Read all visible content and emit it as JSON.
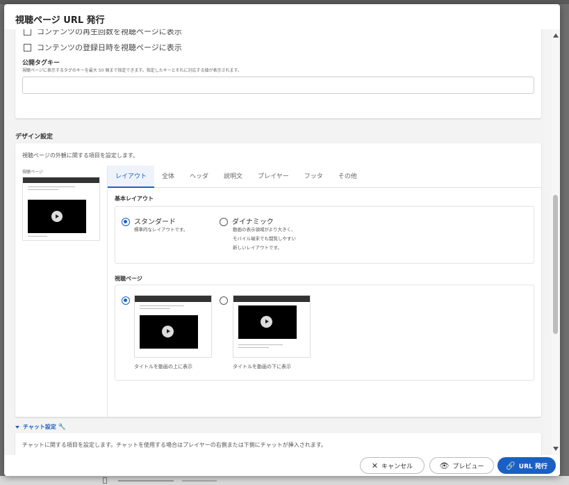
{
  "modal": {
    "title": "視聴ページ URL 発行"
  },
  "content_section": {
    "checkbox_play_count": "コンテンツの再生回数を視聴ページに表示",
    "checkbox_registered_date": "コンテンツの登録日時を視聴ページに表示",
    "public_tag_key": {
      "label": "公開タグキー",
      "help": "視聴ページに表示するタグのキーを最大 50 個まで指定できます。指定したキーとそれに対応する値が表示されます。",
      "value": ""
    }
  },
  "design_section": {
    "heading": "デザイン設定",
    "description": "視聴ページの外観に関する項目を設定します。",
    "preview_label": "視聴ページ",
    "tabs": [
      {
        "label": "レイアウト",
        "active": true
      },
      {
        "label": "全体",
        "active": false
      },
      {
        "label": "ヘッダ",
        "active": false
      },
      {
        "label": "説明文",
        "active": false
      },
      {
        "label": "プレイヤー",
        "active": false
      },
      {
        "label": "フッタ",
        "active": false
      },
      {
        "label": "その他",
        "active": false
      }
    ],
    "basic_layout": {
      "heading": "基本レイアウト",
      "options": [
        {
          "title": "スタンダード",
          "desc": [
            "標準的なレイアウトです。"
          ],
          "selected": true
        },
        {
          "title": "ダイナミック",
          "desc": [
            "動画の表示領域がより大きく、",
            "モバイル端末でも閲覧しやすい",
            "新しいレイアウトです。"
          ],
          "selected": false
        }
      ]
    },
    "watch_page": {
      "heading": "視聴ページ",
      "options": [
        {
          "caption": "タイトルを動画の上に表示",
          "selected": true
        },
        {
          "caption": "タイトルを動画の下に表示",
          "selected": false
        }
      ]
    }
  },
  "chat_section": {
    "heading": "チャット設定",
    "description": "チャットに関する項目を設定します。チャットを使用する場合はプレイヤーの右側または下側にチャットが挿入されます。"
  },
  "footer": {
    "cancel_label": "キャンセル",
    "preview_label": "プレビュー",
    "issue_label": "URL 発行"
  },
  "colors": {
    "accent": "#1a5fc4",
    "surface": "#f3f3f3"
  },
  "icons": {
    "cancel": "close-icon",
    "preview": "eye-icon",
    "issue": "link-icon",
    "chat": "wrench-icon"
  }
}
